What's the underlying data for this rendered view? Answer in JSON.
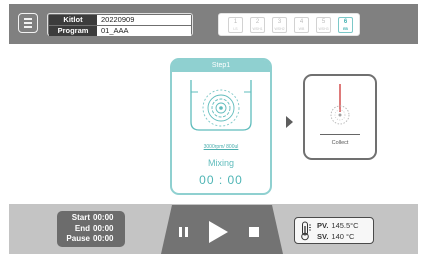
{
  "header": {
    "kitlot_label": "Kitlot",
    "kitlot_value": "20220909",
    "program_label": "Program",
    "program_value": "01_AAA",
    "steps": [
      {
        "num": "1",
        "label": "LS"
      },
      {
        "num": "2",
        "label": "WSH1"
      },
      {
        "num": "3",
        "label": "WSH2"
      },
      {
        "num": "4",
        "label": "WB"
      },
      {
        "num": "5",
        "label": "WSH3"
      },
      {
        "num": "6",
        "label": "EB"
      }
    ],
    "active_step": 6
  },
  "main": {
    "step_title": "Step1",
    "speed": "3000rpm/ 800ul",
    "mode": "Mixing",
    "timer": "00 : 00",
    "collect_label": "Collect"
  },
  "footer": {
    "start_label": "Start",
    "start_value": "00:00",
    "end_label": "End",
    "end_value": "00:00",
    "pause_label": "Pause",
    "pause_value": "00:00",
    "pv_label": "PV.",
    "pv_value": "145.5°C",
    "sv_label": "SV.",
    "sv_value": "140  °C"
  },
  "icons": {
    "menu": "menu-icon",
    "pause": "pause-icon",
    "play": "play-icon",
    "stop": "stop-icon",
    "thermometer": "thermometer-icon",
    "mixing": "mixing-vessel-icon",
    "collect": "collect-vessel-icon",
    "next": "chevron-right-icon"
  },
  "colors": {
    "accent": "#8fd0d0",
    "header": "#808080",
    "footer": "#c4c4c4"
  }
}
